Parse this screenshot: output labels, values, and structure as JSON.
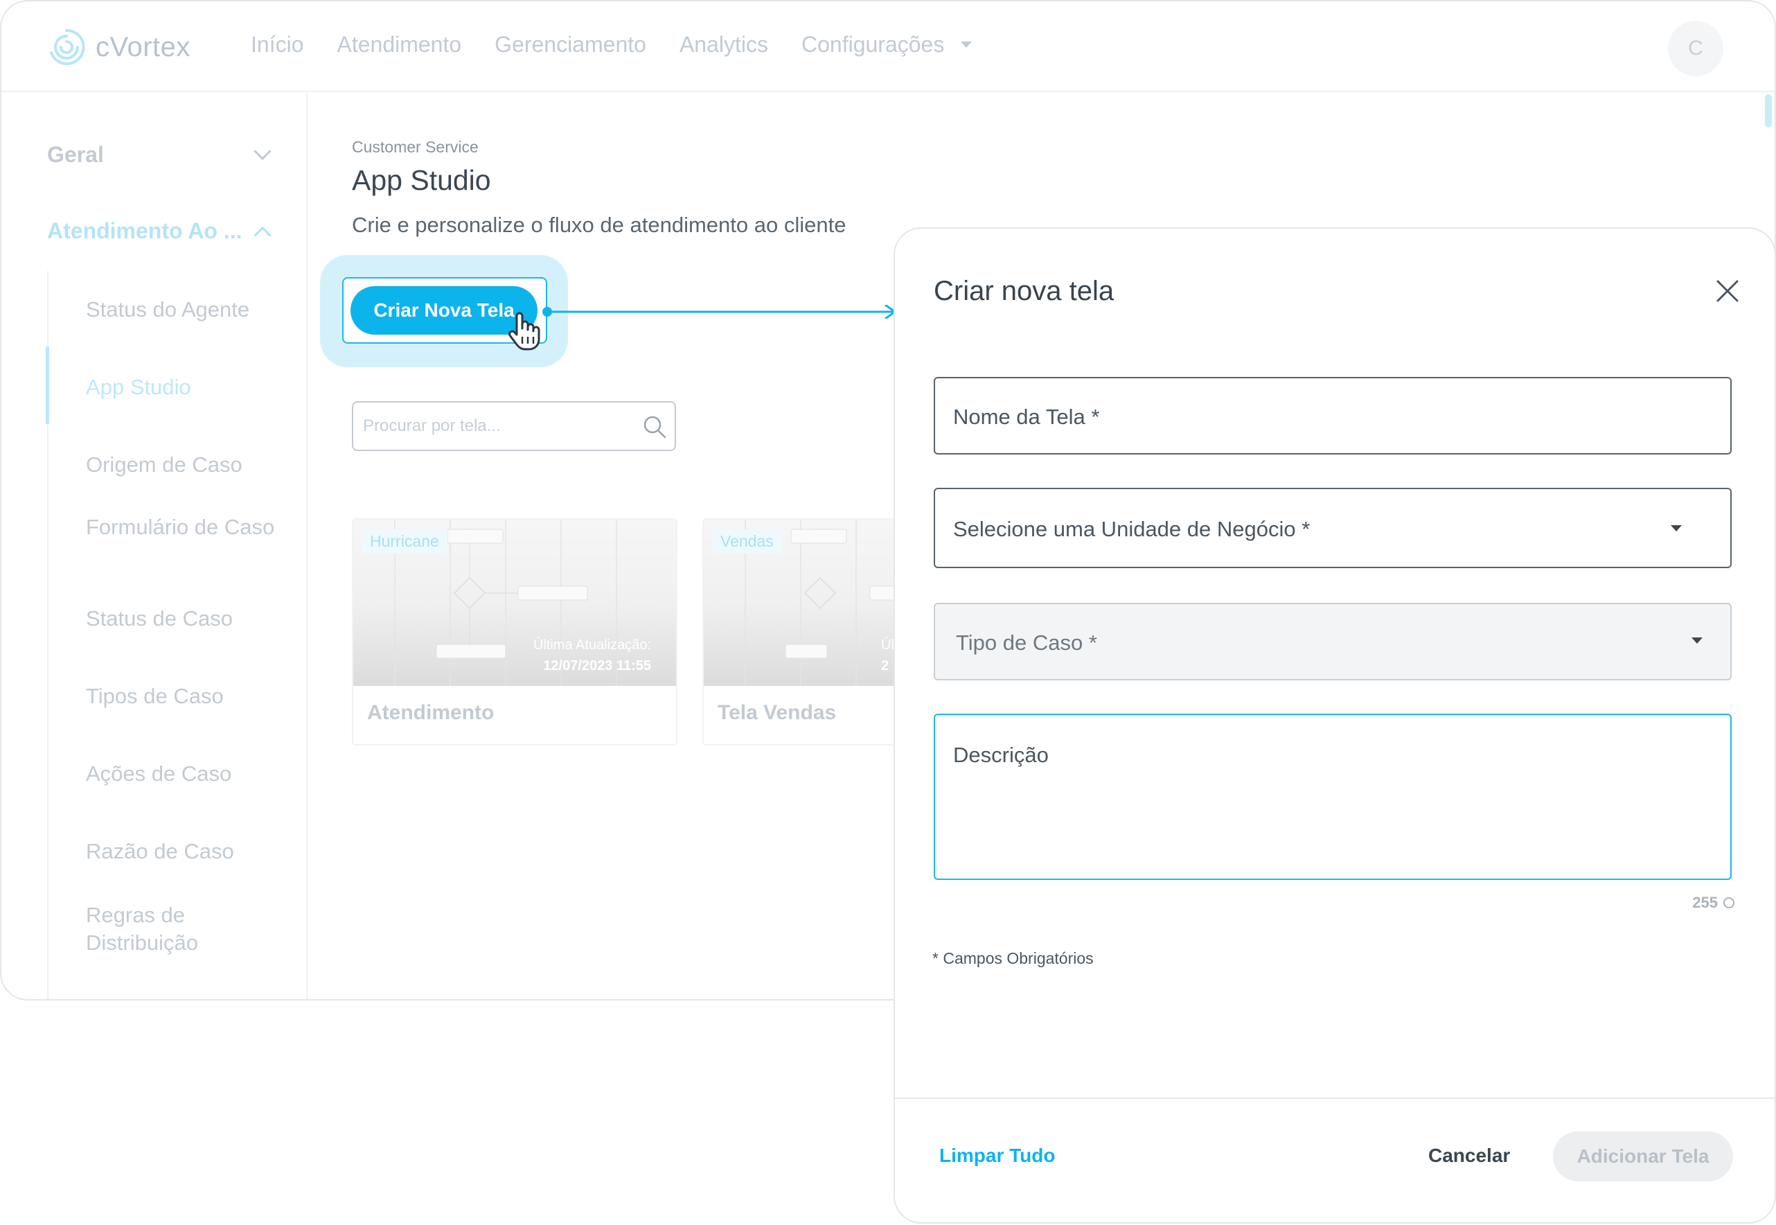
{
  "brand": {
    "name": "cVortex",
    "accent": "#0cb4ec"
  },
  "nav": {
    "items": [
      "Início",
      "Atendimento",
      "Gerenciamento",
      "Analytics",
      "Configurações"
    ],
    "avatar_initial": "C"
  },
  "sidebar": {
    "groups": [
      {
        "label": "Geral",
        "expanded": false
      },
      {
        "label": "Atendimento Ao ...",
        "expanded": true
      }
    ],
    "items": [
      "Status do Agente",
      "App Studio",
      "Origem de Caso",
      "Formulário de Caso",
      "Status de Caso",
      "Tipos de Caso",
      "Ações de Caso",
      "Razão de Caso",
      "Regras de Distribuição"
    ],
    "active_item": "App Studio"
  },
  "main": {
    "breadcrumb": "Customer Service",
    "title": "App Studio",
    "description": "Crie e personalize o fluxo de atendimento ao cliente",
    "create_button": "Criar Nova Tela",
    "search_placeholder": "Procurar por tela...",
    "cards": [
      {
        "tag": "Hurricane",
        "meta_label": "Última Atualização:",
        "meta_date": "12/07/2023 11:55",
        "name": "Atendimento"
      },
      {
        "tag": "Vendas",
        "meta_label": "Úl",
        "meta_date": "2",
        "name": "Tela Vendas"
      }
    ]
  },
  "drawer": {
    "title": "Criar nova tela",
    "fields": {
      "name": "Nome da Tela *",
      "business_unit": "Selecione uma Unidade de Negócio *",
      "case_type": "Tipo de Caso *",
      "description": "Descrição"
    },
    "counter": "255",
    "required_note": "* Campos Obrigatórios",
    "clear_button": "Limpar Tudo",
    "cancel_button": "Cancelar",
    "add_button": "Adicionar Tela"
  }
}
